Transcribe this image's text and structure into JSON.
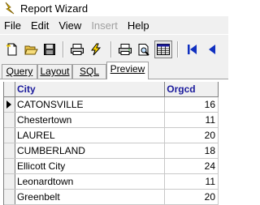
{
  "window": {
    "title": "Report Wizard"
  },
  "menu": [
    {
      "label": "File",
      "enabled": true
    },
    {
      "label": "Edit",
      "enabled": true
    },
    {
      "label": "View",
      "enabled": true
    },
    {
      "label": "Insert",
      "enabled": false
    },
    {
      "label": "Help",
      "enabled": true
    }
  ],
  "toolbar": {
    "icons": [
      "new-document-icon",
      "open-folder-icon",
      "save-icon",
      "print-setup-icon",
      "run-lightning-icon",
      "print-icon",
      "print-preview-icon",
      "table-grid-icon",
      "first-record-icon",
      "previous-record-icon"
    ],
    "pressed": "table-grid-icon"
  },
  "tabs": [
    {
      "label": "Query",
      "active": false
    },
    {
      "label": "Layout",
      "active": false
    },
    {
      "label": "SQL",
      "active": false
    },
    {
      "label": "Preview",
      "active": true
    }
  ],
  "grid": {
    "columns": [
      "City",
      "Orgcd"
    ],
    "rows": [
      {
        "city": "CATONSVILLE",
        "orgcd": "16"
      },
      {
        "city": "Chestertown",
        "orgcd": "11"
      },
      {
        "city": "LAUREL",
        "orgcd": "20"
      },
      {
        "city": "CUMBERLAND",
        "orgcd": "18"
      },
      {
        "city": "Ellicott City",
        "orgcd": "24"
      },
      {
        "city": "Leonardtown",
        "orgcd": "11"
      },
      {
        "city": "Greenbelt",
        "orgcd": "20"
      }
    ],
    "current_row": 0
  },
  "colors": {
    "header_text": "#1a1a9c",
    "chrome": "#f0f0f0",
    "nav_arrow": "#1030c0"
  }
}
